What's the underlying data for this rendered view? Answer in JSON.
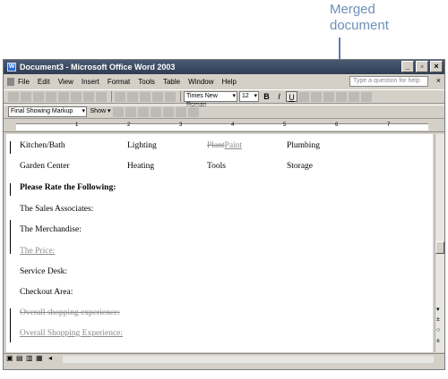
{
  "callout": {
    "line1": "Merged",
    "line2": "document"
  },
  "window": {
    "title": "Document3 - Microsoft Office Word 2003"
  },
  "menu": {
    "items": [
      "File",
      "Edit",
      "View",
      "Insert",
      "Format",
      "Tools",
      "Table",
      "Window",
      "Help"
    ],
    "help_placeholder": "Type a question for help",
    "close": "×"
  },
  "toolbar": {
    "font": "Times New Roman",
    "size": "12",
    "bold": "B",
    "italic": "I",
    "underline": "U"
  },
  "review": {
    "markup": "Final Showing Markup",
    "show": "Show ▾"
  },
  "ruler": {
    "numbers": [
      "1",
      "2",
      "3",
      "4",
      "5",
      "6",
      "7"
    ]
  },
  "doc": {
    "r1": [
      "Kitchen/Bath",
      "Lighting",
      "Plant",
      "Paint",
      "Plumbing"
    ],
    "r2": [
      "Garden Center",
      "Heating",
      "Tools",
      "Storage"
    ],
    "rate": "Please Rate the Following:",
    "sales": "The Sales Associates:",
    "merch": "The Merchandise:",
    "price": "The Price:",
    "service": "Service Desk:",
    "checkout": "Checkout Area:",
    "overall_old": "Overall shopping experience:",
    "overall_new": "Overall Shopping Experience:"
  }
}
